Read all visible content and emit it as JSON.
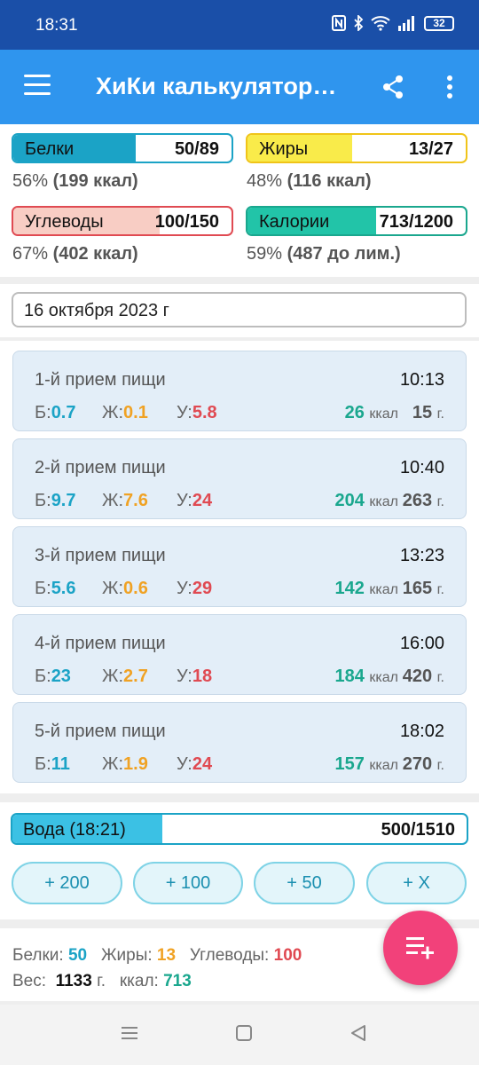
{
  "status_bar": {
    "time": "18:31",
    "battery": "32"
  },
  "app_bar": {
    "title": "ХиКи калькулятор…",
    "icons": [
      "menu-icon",
      "share-icon",
      "more-vert-icon"
    ]
  },
  "summary": {
    "protein": {
      "label": "Белки",
      "value": "50/89",
      "progress": 0.56,
      "sub_pct": "56% ",
      "sub_detail": "(199 ккал)"
    },
    "fat": {
      "label": "Жиры",
      "value": "13/27",
      "progress": 0.48,
      "sub_pct": "48% ",
      "sub_detail": "(116 ккал)"
    },
    "carbs": {
      "label": "Углеводы",
      "value": "100/150",
      "progress": 0.67,
      "sub_pct": "67% ",
      "sub_detail": "(402 ккал)"
    },
    "calories": {
      "label": "Калории",
      "value": "713/1200",
      "progress": 0.59,
      "sub_pct": "59% ",
      "sub_detail": "(487 до лим.)"
    }
  },
  "date": {
    "value": "16 октября 2023 г"
  },
  "meals": [
    {
      "name": "1-й прием пищи",
      "time": "10:13",
      "b_label": "Б:",
      "b": "0.7",
      "z_label": "Ж:",
      "z": "0.1",
      "u_label": "У:",
      "u": "5.8",
      "kcal": "26",
      "kcal_unit": "ккал",
      "grams": "15",
      "grams_unit": "г."
    },
    {
      "name": "2-й прием пищи",
      "time": "10:40",
      "b_label": "Б:",
      "b": "9.7",
      "z_label": "Ж:",
      "z": "7.6",
      "u_label": "У:",
      "u": "24",
      "kcal": "204",
      "kcal_unit": "ккал",
      "grams": "263",
      "grams_unit": "г."
    },
    {
      "name": "3-й прием пищи",
      "time": "13:23",
      "b_label": "Б:",
      "b": "5.6",
      "z_label": "Ж:",
      "z": "0.6",
      "u_label": "У:",
      "u": "29",
      "kcal": "142",
      "kcal_unit": "ккал",
      "grams": "165",
      "grams_unit": "г."
    },
    {
      "name": "4-й прием пищи",
      "time": "16:00",
      "b_label": "Б:",
      "b": "23",
      "z_label": "Ж:",
      "z": "2.7",
      "u_label": "У:",
      "u": "18",
      "kcal": "184",
      "kcal_unit": "ккал",
      "grams": "420",
      "grams_unit": "г."
    },
    {
      "name": "5-й прием пищи",
      "time": "18:02",
      "b_label": "Б:",
      "b": "11",
      "z_label": "Ж:",
      "z": "1.9",
      "u_label": "У:",
      "u": "24",
      "kcal": "157",
      "kcal_unit": "ккал",
      "grams": "270",
      "grams_unit": "г."
    }
  ],
  "water": {
    "label": "Вода (18:21)",
    "value": "500/1510",
    "progress": 0.33,
    "buttons": [
      "+ 200",
      "+ 100",
      "+ 50",
      "+ X"
    ]
  },
  "footer": {
    "protein_label": "Белки:",
    "protein": "50",
    "fat_label": "Жиры:",
    "fat": "13",
    "carbs_label": "Углеводы:",
    "carbs": "100",
    "weight_label": "Вес:",
    "weight": "1133",
    "weight_unit": "г.",
    "kcal_label": "ккал:",
    "kcal": "713"
  },
  "colors": {
    "status_bar": "#1a4fa8",
    "app_bar": "#2f95ee",
    "protein": "#1ba3c6",
    "fat": "#f0c419",
    "carbs": "#e04a52",
    "calories": "#1aa78e",
    "fab": "#f2417a"
  }
}
